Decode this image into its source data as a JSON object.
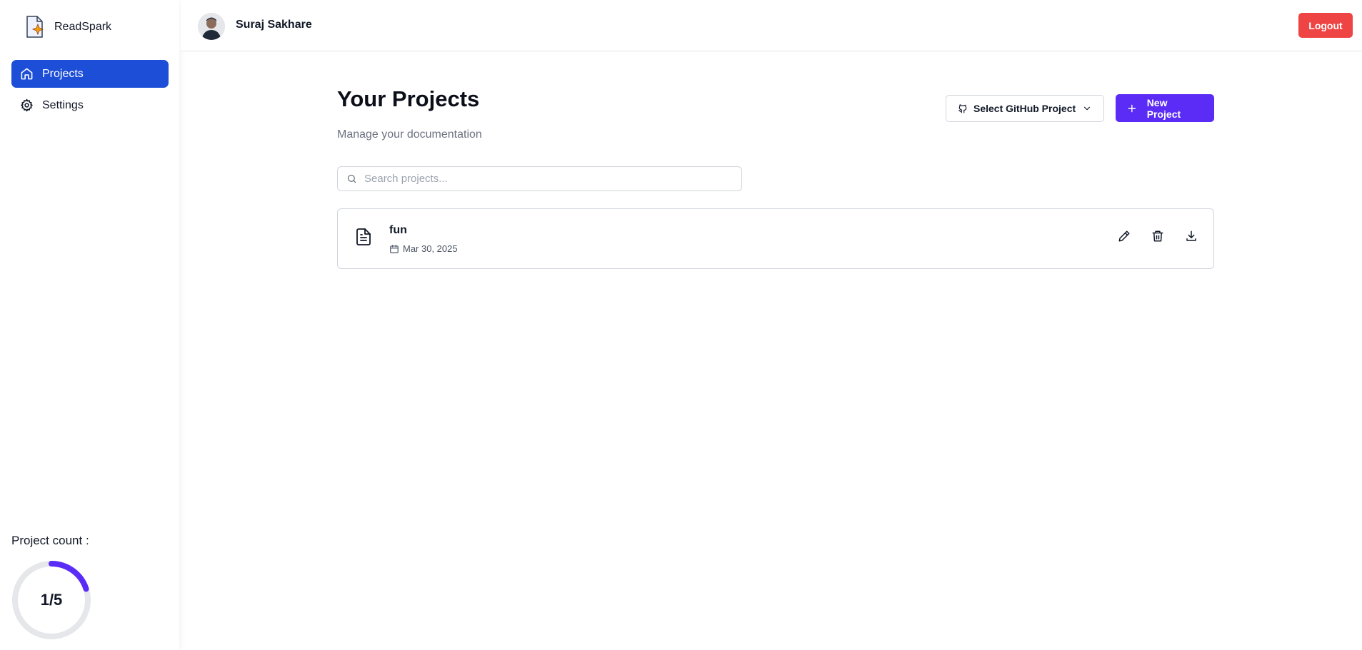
{
  "app": {
    "name": "ReadSpark"
  },
  "sidebar": {
    "items": [
      {
        "label": "Projects",
        "icon": "home-icon",
        "active": true
      },
      {
        "label": "Settings",
        "icon": "gear-icon",
        "active": false
      }
    ],
    "project_count_label": "Project count :",
    "project_count_text": "1/5",
    "project_count": {
      "used": 1,
      "max": 5
    }
  },
  "header": {
    "user_name": "Suraj Sakhare",
    "logout_label": "Logout"
  },
  "main": {
    "title": "Your Projects",
    "subtitle": "Manage your documentation",
    "github_select_label": "Select GitHub Project",
    "new_project_label": "New Project",
    "search_placeholder": "Search projects...",
    "projects": [
      {
        "name": "fun",
        "date": "Mar 30, 2025"
      }
    ]
  },
  "colors": {
    "primary_nav": "#1d4ed8",
    "accent_purple": "#5b2cf6",
    "logout_red": "#ef4444"
  }
}
